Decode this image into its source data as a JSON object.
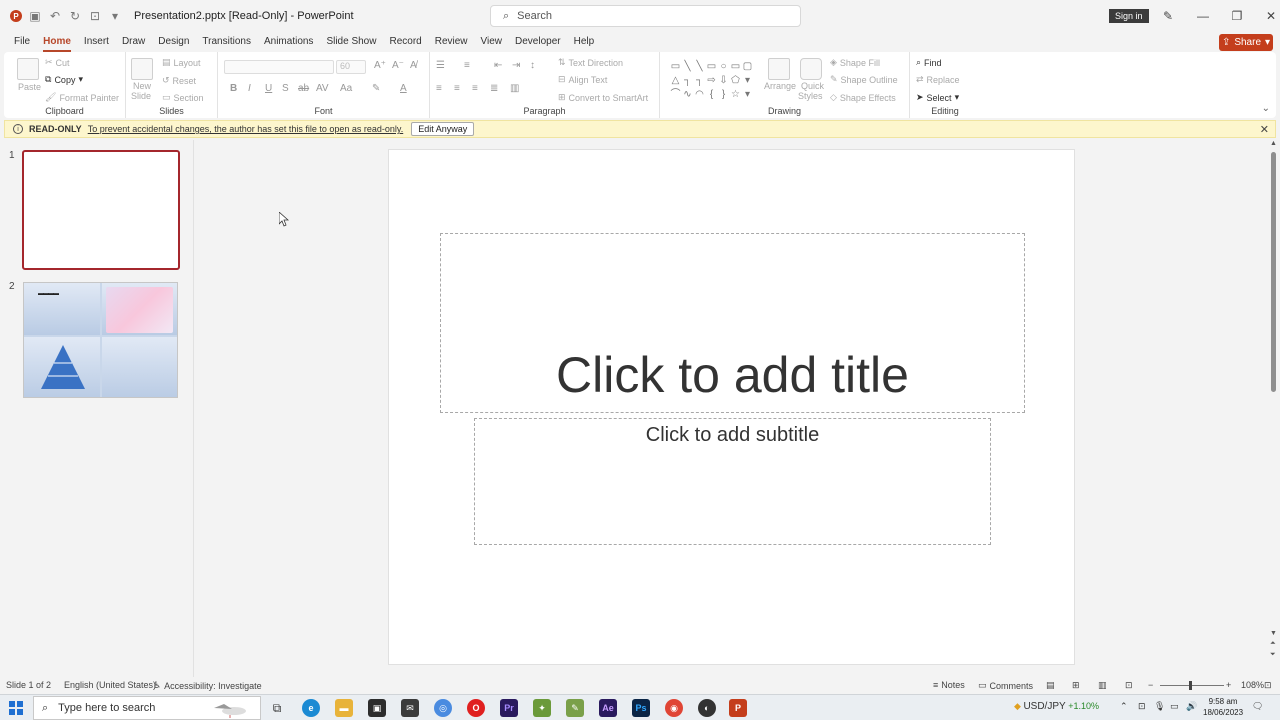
{
  "titlebar": {
    "title": "Presentation2.pptx [Read-Only] - PowerPoint",
    "search_placeholder": "Search",
    "signin": "Sign in"
  },
  "tabs": [
    "File",
    "Home",
    "Insert",
    "Draw",
    "Design",
    "Transitions",
    "Animations",
    "Slide Show",
    "Record",
    "Review",
    "View",
    "Developer",
    "Help"
  ],
  "active_tab": "Home",
  "share": "Share",
  "ribbon": {
    "clipboard": {
      "label": "Clipboard",
      "paste": "Paste",
      "cut": "Cut",
      "copy": "Copy",
      "format_painter": "Format Painter"
    },
    "slides": {
      "label": "Slides",
      "new_slide_1": "New",
      "new_slide_2": "Slide",
      "layout": "Layout",
      "reset": "Reset",
      "section": "Section"
    },
    "font": {
      "label": "Font",
      "size": "60",
      "bold": "B",
      "italic": "I",
      "underline": "U",
      "strike": "S",
      "strike2": "ab"
    },
    "paragraph": {
      "label": "Paragraph",
      "text_direction": "Text Direction",
      "align_text": "Align Text",
      "smartart": "Convert to SmartArt"
    },
    "drawing": {
      "label": "Drawing",
      "arrange": "Arrange",
      "quick_styles_1": "Quick",
      "quick_styles_2": "Styles",
      "shape_fill": "Shape Fill",
      "shape_outline": "Shape Outline",
      "shape_effects": "Shape Effects"
    },
    "editing": {
      "label": "Editing",
      "find": "Find",
      "replace": "Replace",
      "select": "Select"
    }
  },
  "readonly_bar": {
    "label": "READ-ONLY",
    "message": "To prevent accidental changes, the author has set this file to open as read-only.",
    "button": "Edit Anyway"
  },
  "thumbnails": [
    {
      "number": "1"
    },
    {
      "number": "2",
      "mini_title": "▬▬▬▬"
    }
  ],
  "slide": {
    "title_placeholder": "Click to add title",
    "subtitle_placeholder": "Click to add subtitle"
  },
  "statusbar": {
    "slide_info": "Slide 1 of 2",
    "language": "English (United States)",
    "accessibility": "Accessibility: Investigate",
    "notes": "Notes",
    "comments": "Comments",
    "zoom": "108%"
  },
  "taskbar": {
    "search_placeholder": "Type here to search",
    "currency": "USD/JPY",
    "currency_change": "+1.10%",
    "time": "9:58 am",
    "date": "18/06/2023"
  },
  "colors": {
    "accent": "#b7472a",
    "share_bg": "#c43e1c",
    "readonly_bg": "#fdf6cd",
    "thumb_selected_border": "#a4262c"
  }
}
